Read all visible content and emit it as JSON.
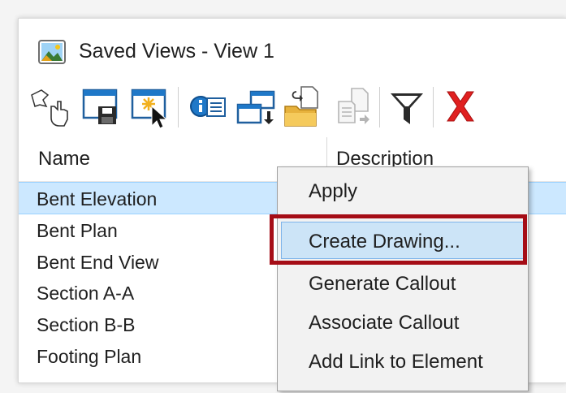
{
  "window": {
    "title": "Saved Views - View 1"
  },
  "toolbar": {
    "buttons": [
      {
        "icon": "pointer-select-icon"
      },
      {
        "icon": "save-view-icon"
      },
      {
        "icon": "new-view-icon"
      },
      {
        "icon": "properties-icon"
      },
      {
        "icon": "apply-view-icon"
      },
      {
        "icon": "import-icon"
      },
      {
        "icon": "export-icon"
      },
      {
        "icon": "filter-icon"
      },
      {
        "icon": "delete-icon"
      }
    ]
  },
  "grid": {
    "columns": [
      "Name",
      "Description"
    ],
    "rows": [
      {
        "name": "Bent Elevation",
        "selected": true
      },
      {
        "name": "Bent Plan"
      },
      {
        "name": "Bent End View"
      },
      {
        "name": "Section A-A"
      },
      {
        "name": "Section B-B"
      },
      {
        "name": "Footing Plan"
      }
    ]
  },
  "context_menu": {
    "items": [
      "Apply",
      "Create Drawing...",
      "Generate Callout",
      "Associate Callout",
      "Add Link to Element"
    ],
    "highlighted_index": 1
  },
  "colors": {
    "selection": "#cce8ff",
    "highlight_box": "#a50d16",
    "delete_red": "#e02020"
  }
}
